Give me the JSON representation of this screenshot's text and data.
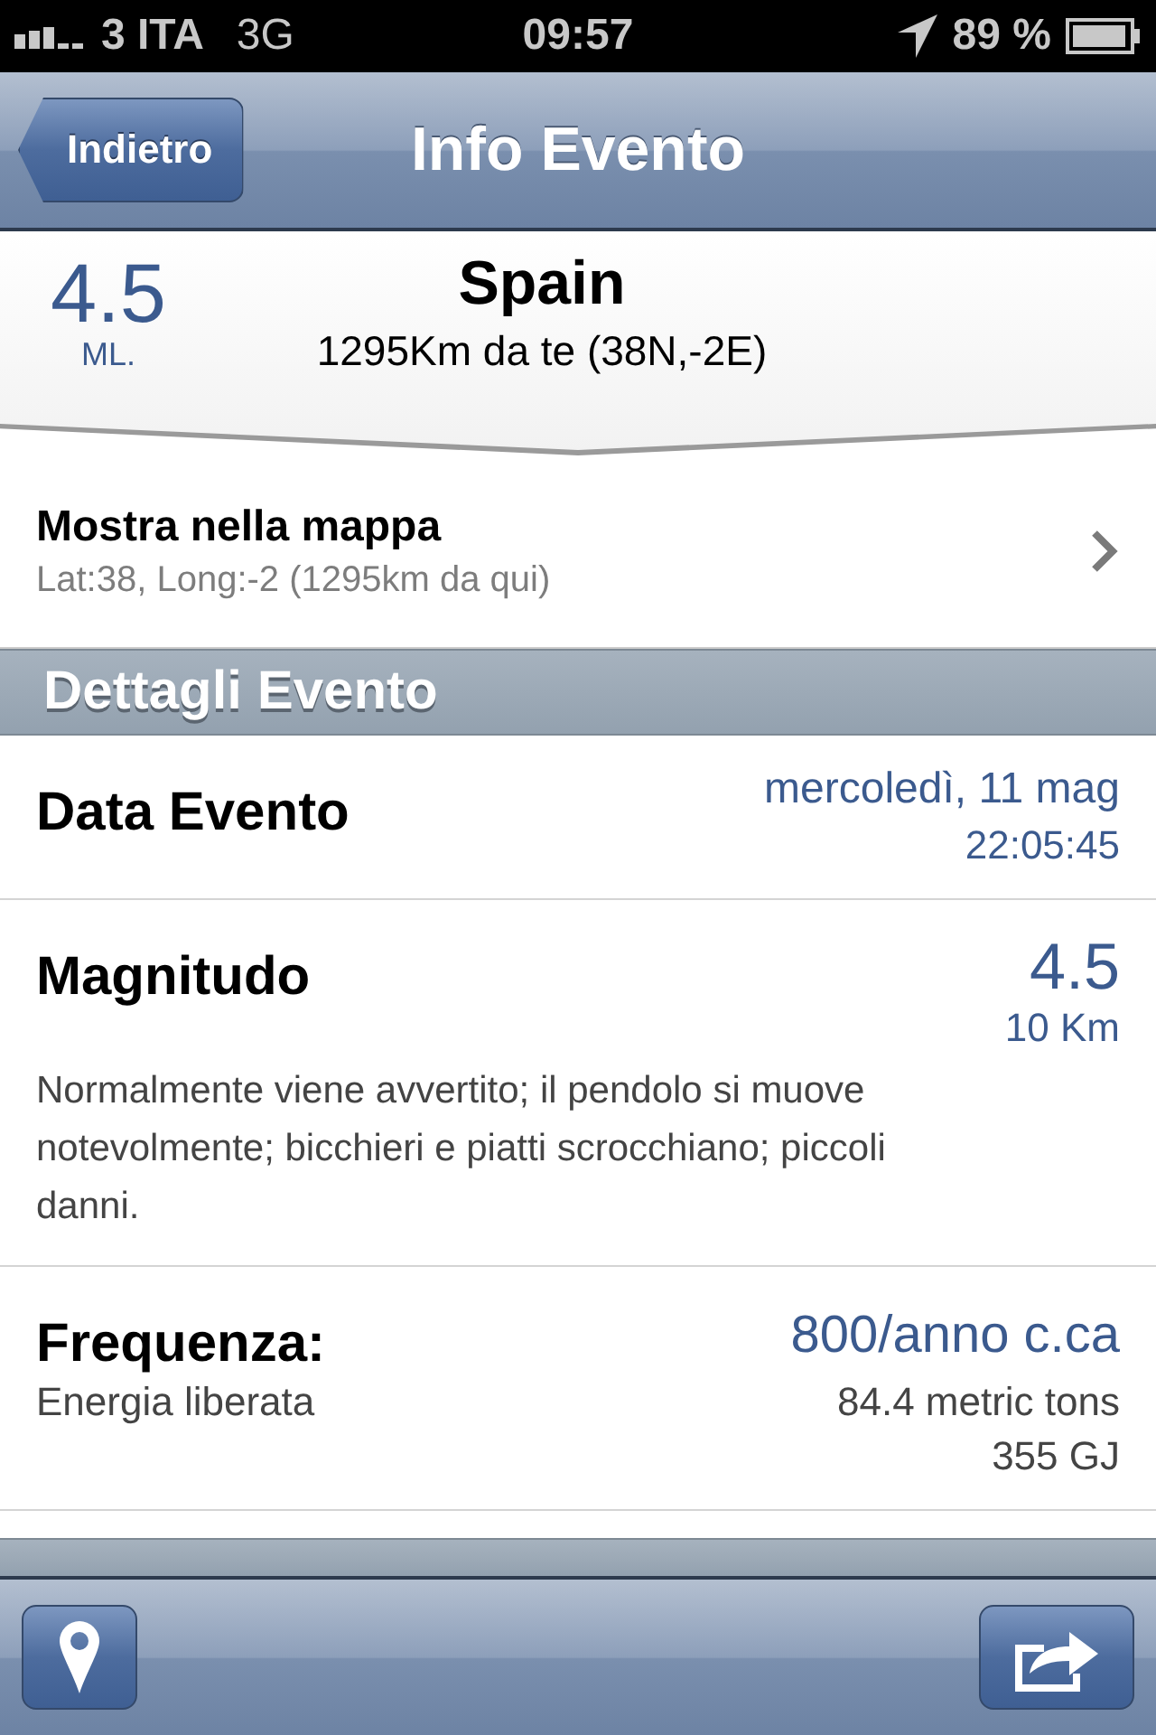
{
  "status_bar": {
    "carrier": "3 ITA",
    "network": "3G",
    "time": "09:57",
    "battery": "89 %"
  },
  "nav_bar": {
    "back_button": "Indietro",
    "title": "Info Evento"
  },
  "summary": {
    "magnitude": "4.5",
    "unit": "ML.",
    "place": "Spain",
    "distance": "1295Km da te (38N,-2E)"
  },
  "map_row": {
    "title": "Mostra nella mappa",
    "subtitle": "Lat:38, Long:-2 (1295km da qui)"
  },
  "sections": [
    {
      "title": "Dettagli Evento",
      "rows": [
        {
          "kind": "date",
          "label": "Data Evento",
          "values": [
            "mercoledì, 11 mag",
            "22:05:45"
          ]
        },
        {
          "kind": "magnitude",
          "label": "Magnitudo",
          "values": [
            "4.5",
            "10 Km"
          ],
          "note": "Normalmente viene avvertito; il pendolo si muove notevolmente; bicchieri e piatti scrocchiano; piccoli danni."
        },
        {
          "kind": "frequency",
          "label": "Frequenza:",
          "values": [
            "800/anno c.ca"
          ],
          "sub_label": "Energia liberata",
          "sub_values": [
            "84.4 metric tons",
            "355 GJ"
          ]
        }
      ]
    }
  ],
  "toolbar": {
    "buttons": [
      {
        "kind": "map"
      },
      {
        "kind": "share"
      }
    ]
  }
}
